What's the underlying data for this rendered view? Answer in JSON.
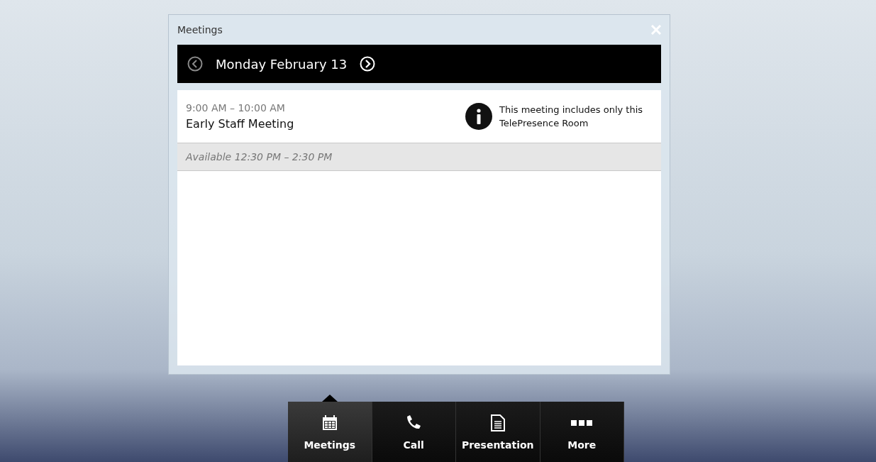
{
  "dialog": {
    "title": "Meetings",
    "date": "Monday February 13",
    "entries": [
      {
        "kind": "meeting",
        "time": "9:00 AM – 10:00 AM",
        "title": "Early Staff Meeting",
        "note": "This meeting includes only this TelePresence Room"
      },
      {
        "kind": "available",
        "text": "Available 12:30 PM – 2:30 PM"
      }
    ]
  },
  "toolbar": [
    {
      "kind": "calendar",
      "label": "Meetings",
      "selected": true
    },
    {
      "kind": "phone",
      "label": "Call",
      "selected": false
    },
    {
      "kind": "document",
      "label": "Presentation",
      "selected": false
    },
    {
      "kind": "more",
      "label": "More",
      "selected": false
    }
  ]
}
